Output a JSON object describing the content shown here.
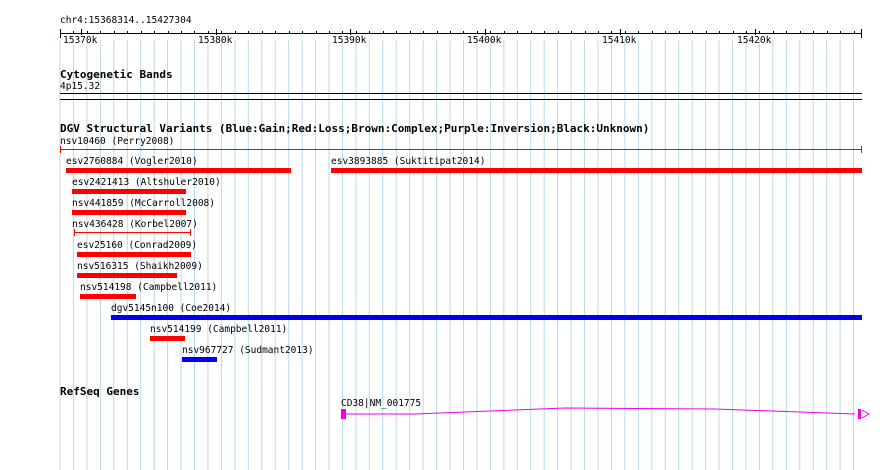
{
  "ruler": {
    "coordinate": "chr4:15368314..15427304",
    "ticks": [
      "15370k",
      "15380k",
      "15390k",
      "15400k",
      "15410k",
      "15420k"
    ]
  },
  "cytobands": {
    "title": "Cytogenetic Bands",
    "band": "4p15.32"
  },
  "dgv": {
    "title": "DGV Structural Variants (Blue:Gain;Red:Loss;Brown:Complex;Purple:Inversion;Black:Unknown)",
    "colors": {
      "gain": "#0000ee",
      "loss": "#ff0000"
    },
    "variants": [
      {
        "label": "nsv10460 (Perry2008)",
        "type": "loss"
      },
      {
        "label": "esv2760884 (Vogler2010)",
        "type": "loss"
      },
      {
        "label": "esv3893885 (Suktitipat2014)",
        "type": "loss"
      },
      {
        "label": "esv2421413 (Altshuler2010)",
        "type": "loss"
      },
      {
        "label": "nsv441859 (McCarroll2008)",
        "type": "loss"
      },
      {
        "label": "nsv436428 (Korbel2007)",
        "type": "loss"
      },
      {
        "label": "esv25160 (Conrad2009)",
        "type": "loss"
      },
      {
        "label": "nsv516315 (Shaikh2009)",
        "type": "loss"
      },
      {
        "label": "nsv514198 (Campbell2011)",
        "type": "loss"
      },
      {
        "label": "dgv5145n100 (Coe2014)",
        "type": "gain"
      },
      {
        "label": "nsv514199 (Campbell2011)",
        "type": "loss"
      },
      {
        "label": "nsv967727 (Sudmant2013)",
        "type": "gain"
      }
    ]
  },
  "refseq": {
    "title": "RefSeq Genes",
    "gene": "CD38|NM_001775",
    "color": "#ee00ee"
  }
}
